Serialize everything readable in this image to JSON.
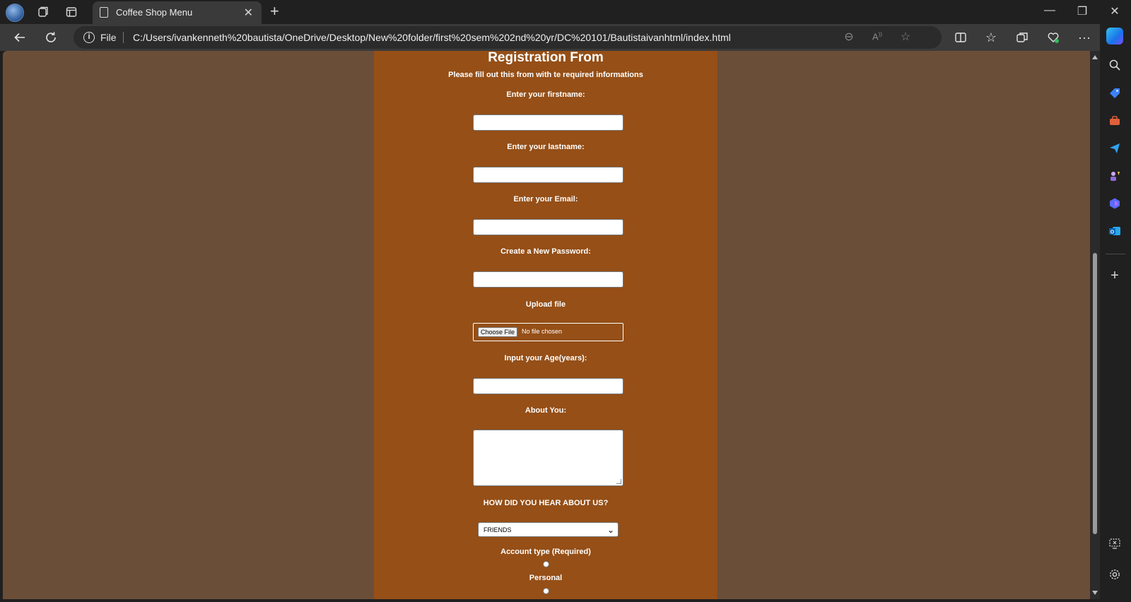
{
  "browser": {
    "tab_title": "Coffee Shop Menu",
    "tab_close": "✕",
    "new_tab": "+",
    "address": {
      "protocol_label": "File",
      "url": "C:/Users/ivankenneth%20bautista/OneDrive/Desktop/New%20folder/first%20sem%202nd%20yr/DC%20101/Bautistaivanhtml/index.html"
    },
    "window_controls": {
      "minimize": "—",
      "restore": "❐",
      "close": "✕"
    }
  },
  "form": {
    "heading": "Registration From",
    "subtitle": "Please fill out this from with te required informations",
    "firstname_label": "Enter your firstname:",
    "lastname_label": "Enter your lastname:",
    "email_label": "Enter your Email:",
    "password_label": "Create a New Password:",
    "upload_label": "Upload file",
    "choose_file_button": "Choose File",
    "no_file_text": "No file chosen",
    "age_label": "Input your Age(years):",
    "about_label": "About You:",
    "hear_label": "HOW DID YOU HEAR ABOUT US?",
    "hear_selected": "FRIENDS",
    "account_type_label": "Account type (Required)",
    "radio_personal_label": "Personal"
  },
  "colors": {
    "page_background": "#6b4e38",
    "form_background": "#954f17",
    "browser_chrome": "#202020",
    "toolbar": "#3a3a3a"
  },
  "icons": {
    "titlebar": [
      "profile-avatar",
      "workspaces-icon",
      "tab-actions-icon"
    ],
    "nav": [
      "back-arrow-icon",
      "refresh-icon"
    ],
    "address": [
      "zoom-out-icon",
      "read-aloud-icon",
      "favorite-star-icon"
    ],
    "toolbar": [
      "split-screen-icon",
      "favorites-icon",
      "collections-icon",
      "browser-essentials-icon",
      "more-menu-icon",
      "copilot-icon"
    ],
    "sidebar": [
      "search-icon",
      "shopping-tag-icon",
      "tools-icon",
      "send-icon",
      "games-icon",
      "microsoft-365-icon",
      "outlook-icon",
      "add-icon",
      "screenshot-icon",
      "settings-icon"
    ]
  }
}
